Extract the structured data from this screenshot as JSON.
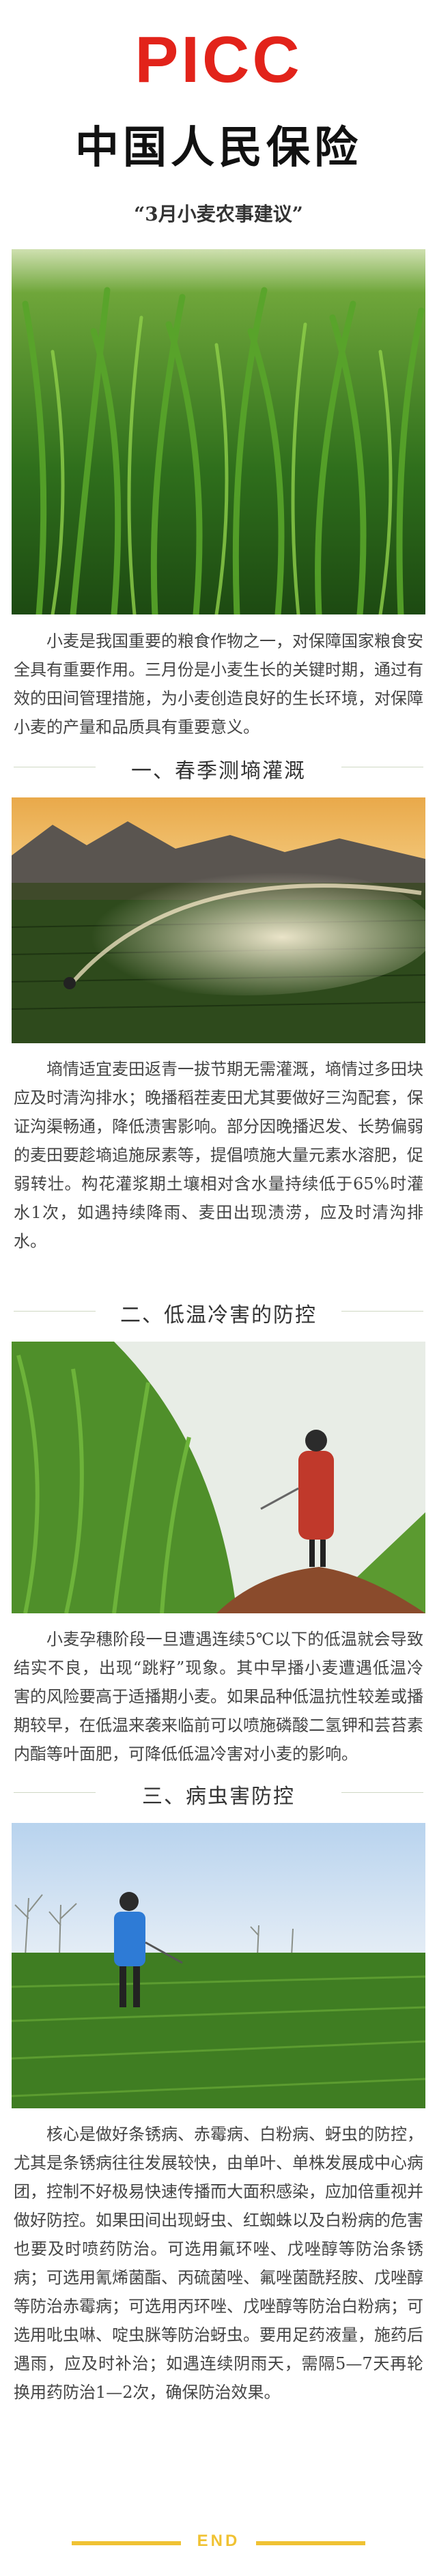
{
  "header": {
    "logo_text": "PICC",
    "company_name": "中国人民保险",
    "subtitle": "“3月小麦农事建议”"
  },
  "intro": "小麦是我国重要的粮食作物之一，对保障国家粮食安全具有重要作用。三月份是小麦生长的关键时期，通过有效的田间管理措施，为小麦创造良好的生长环境，对保障小麦的产量和品质具有重要意义。",
  "sections": [
    {
      "title": "一、春季测墒灌溉",
      "body": "墒情适宜麦田返青一拔节期无需灌溉，墒情过多田块应及时清沟排水；晚播稻茬麦田尤其要做好三沟配套，保证沟渠畅通，降低渍害影响。部分因晚播迟发、长势偏弱的麦田要趁墒追施尿素等，提倡喷施大量元素水溶肥，促弱转壮。构花灌浆期土壤相对含水量持续低于65%时灌水1次，如遇持续降雨、麦田出现渍涝，应及时清沟排水。"
    },
    {
      "title": "二、低温冷害的防控",
      "body": "小麦孕穗阶段一旦遭遇连续5℃以下的低温就会导致结实不良，出现“跳籽”现象。其中早播小麦遭遇低温冷害的风险要高于适播期小麦。如果品种低温抗性较差或播期较早，在低温来袭来临前可以喷施磷酸二氢钾和芸苔素内酯等叶面肥，可降低低温冷害对小麦的影响。"
    },
    {
      "title": "三、病虫害防控",
      "body": "核心是做好条锈病、赤霉病、白粉病、蚜虫的防控，尤其是条锈病往往发展较快，由单叶、单株发展成中心病团，控制不好极易快速传播而大面积感染，应加倍重视并做好防控。如果田间出现蚜虫、红蜘蛛以及白粉病的危害也要及时喷药防治。可选用氟环唑、戊唑醇等防治条锈病；可选用氰烯菌酯、丙硫菌唑、氟唑菌酰羟胺、戊唑醇等防治赤霉病；可选用丙环唑、戊唑醇等防治白粉病；可选用吡虫啉、啶虫脒等防治蚜虫。要用足药液量，施药后遇雨，应及时补治；如遇连续阴雨天，需隔5—7天再轮换用药防治1—2次，确保防治效果。"
    }
  ],
  "footer": {
    "end_label": "END"
  },
  "colors": {
    "brand_red": "#e2231a",
    "accent_yellow": "#f0c233",
    "rule_green": "#cfd8c4"
  },
  "images": [
    {
      "icon": "wheat-closeup-photo"
    },
    {
      "icon": "sprinkler-sunset-photo"
    },
    {
      "icon": "farmer-spraying-photo"
    },
    {
      "icon": "farmer-field-photo"
    }
  ]
}
